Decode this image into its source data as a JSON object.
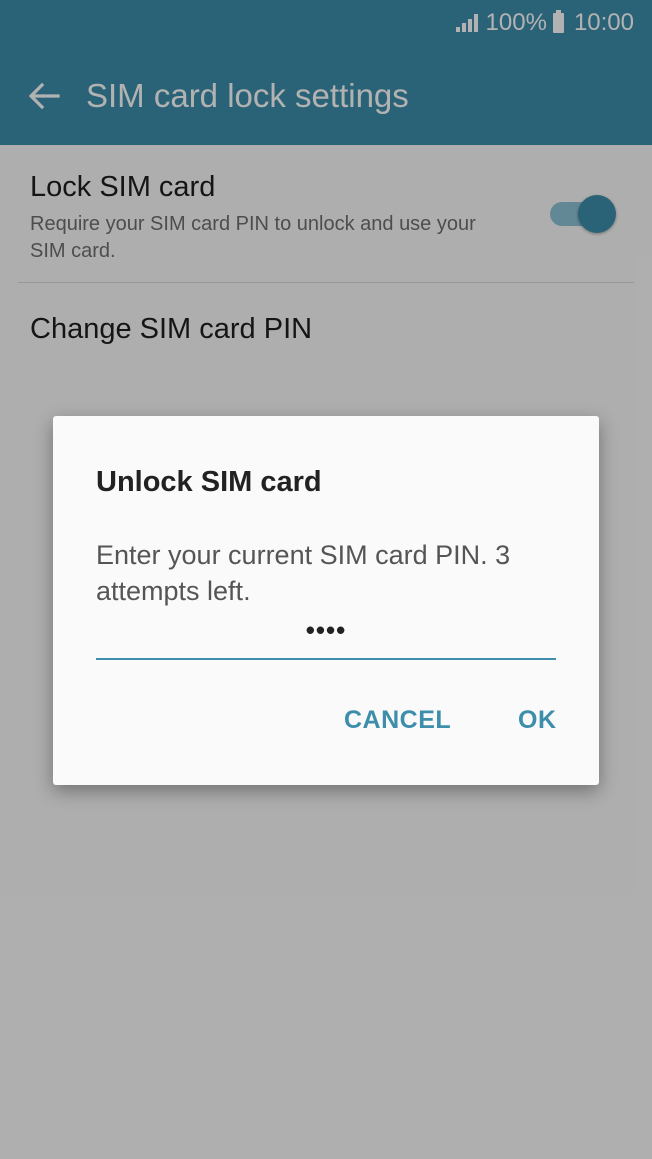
{
  "status_bar": {
    "battery": "100%",
    "time": "10:00"
  },
  "app_bar": {
    "title": "SIM card lock settings"
  },
  "settings": {
    "lock_sim": {
      "title": "Lock SIM card",
      "summary": "Require your SIM card PIN to unlock and use your SIM card.",
      "enabled": true
    },
    "change_pin": {
      "title": "Change SIM card PIN"
    }
  },
  "dialog": {
    "title": "Unlock SIM card",
    "message": "Enter your current SIM card PIN. 3 attempts left.",
    "pin_value": "••••",
    "cancel_label": "CANCEL",
    "ok_label": "OK"
  },
  "colors": {
    "accent": "#3d8eab",
    "scrim": "rgba(0,0,0,0.30)"
  }
}
